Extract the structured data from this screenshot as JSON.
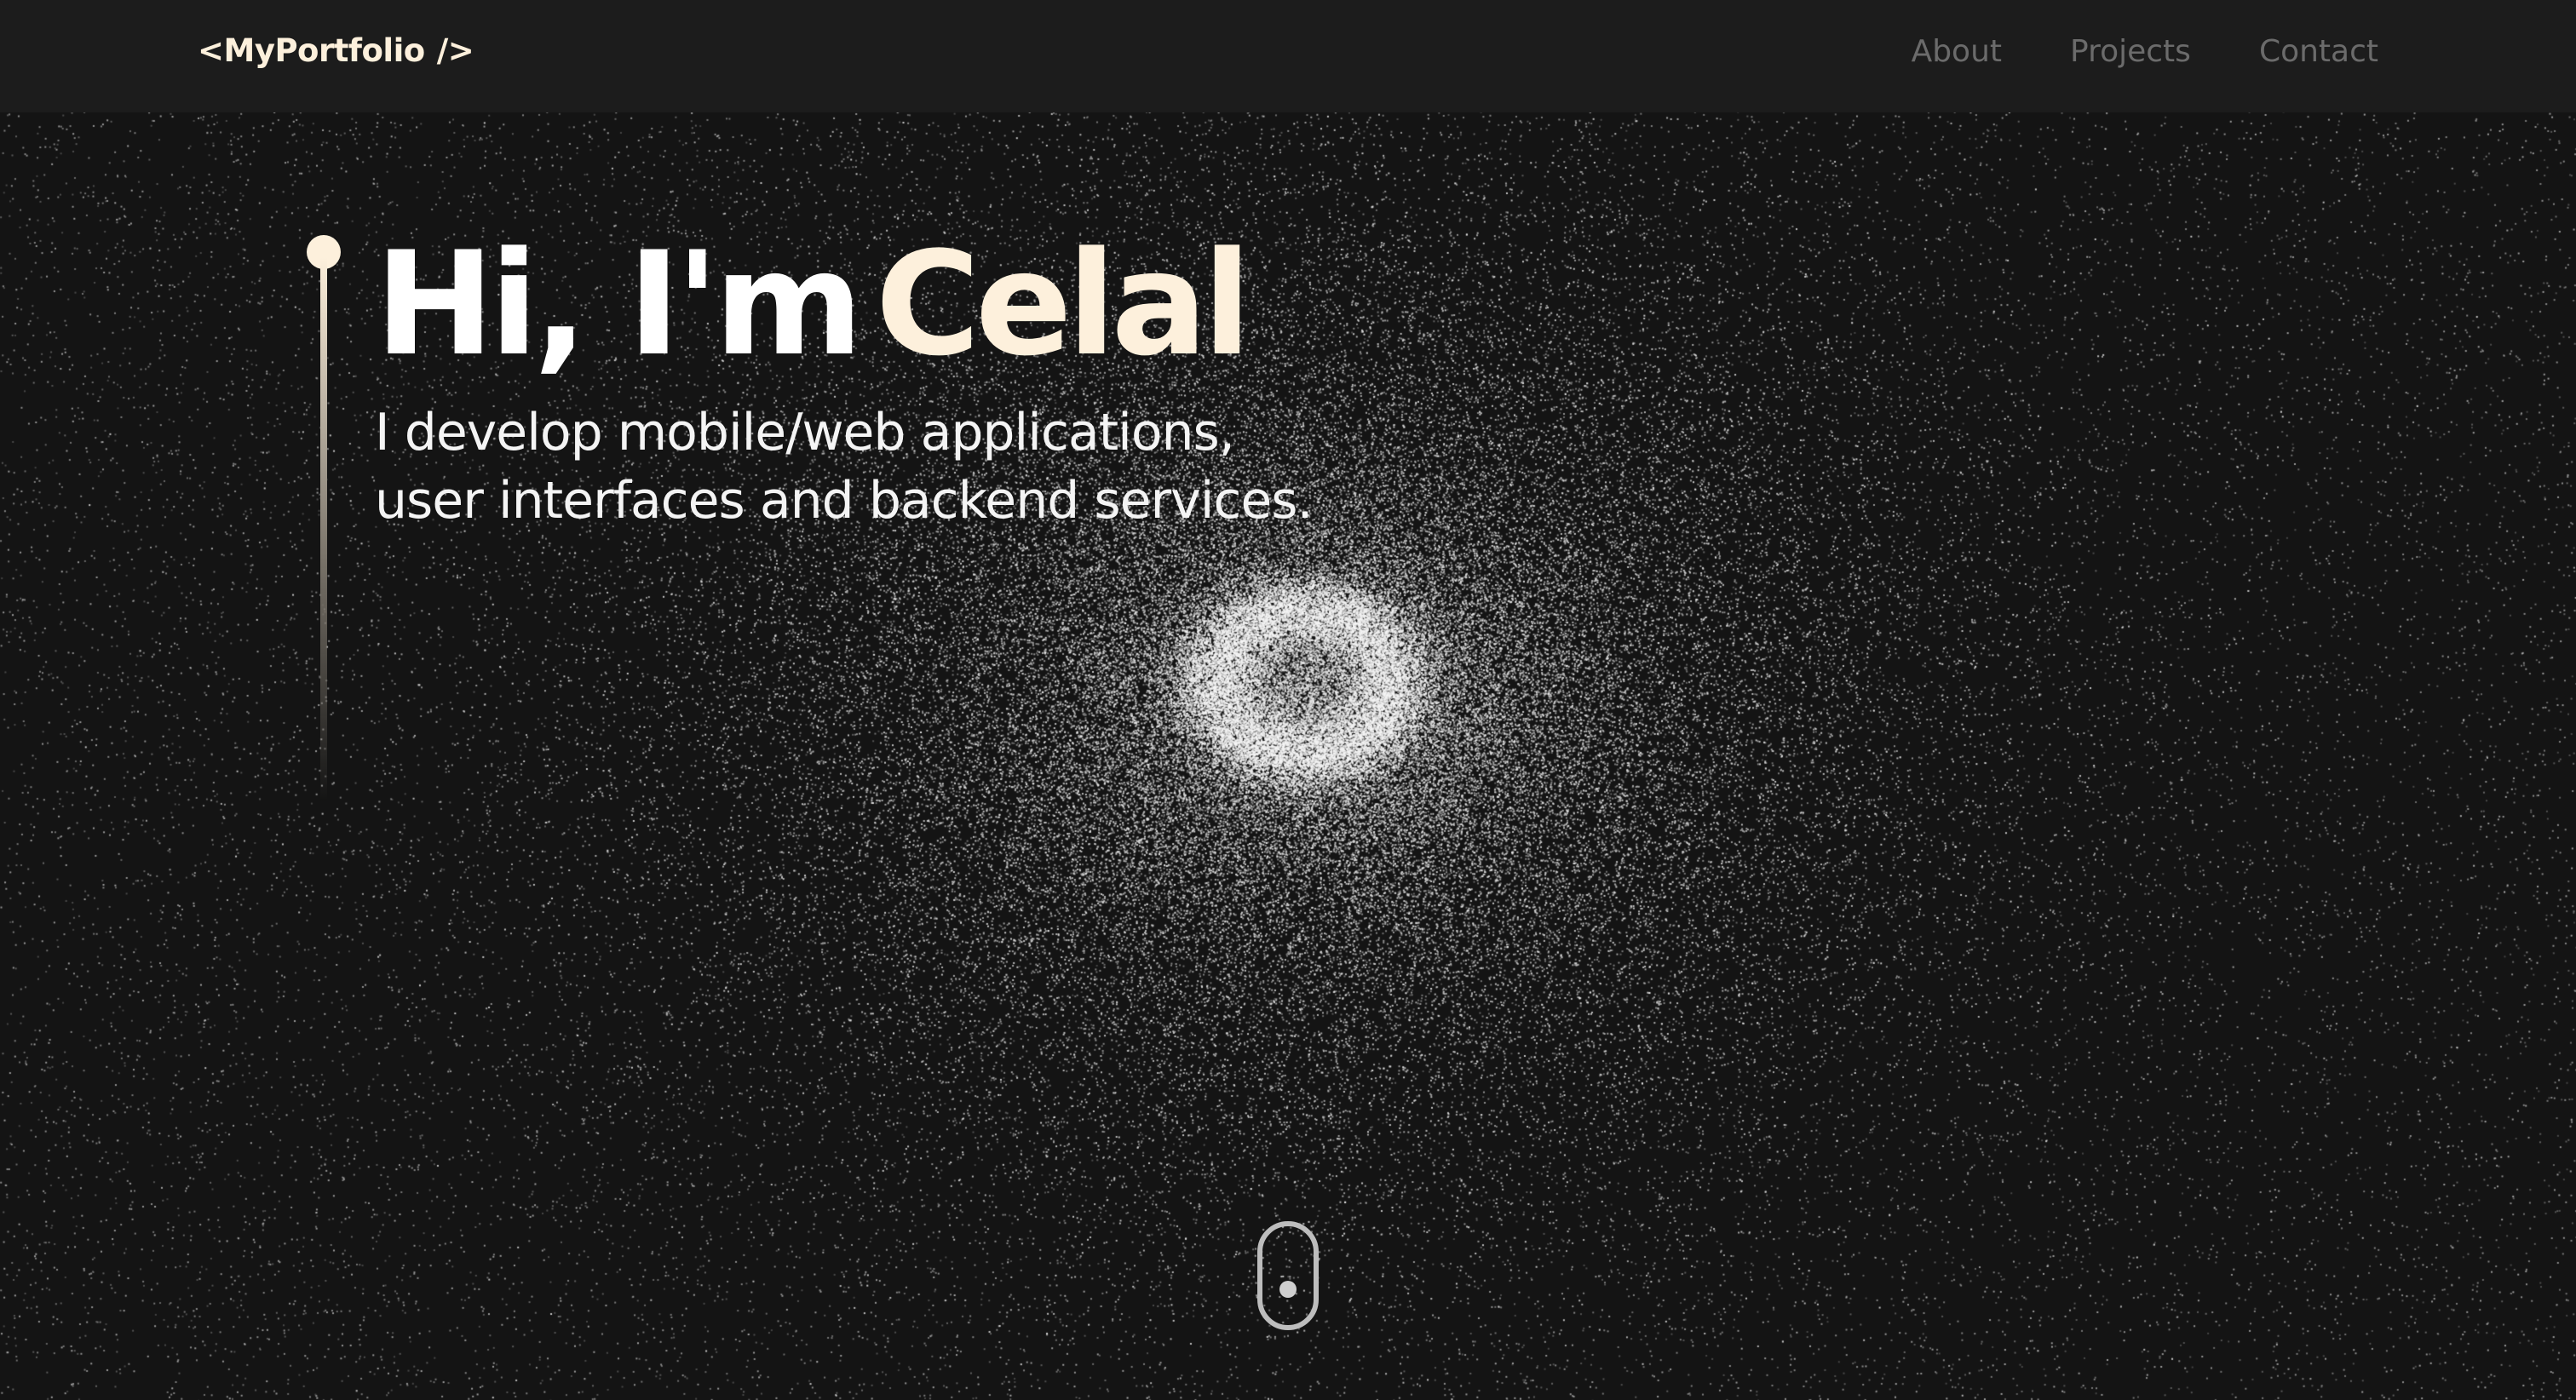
{
  "navbar": {
    "logo_open": "<MyPortfolio",
    "logo_close": "/>",
    "links": [
      {
        "label": "About"
      },
      {
        "label": "Projects"
      },
      {
        "label": "Contact"
      }
    ]
  },
  "hero": {
    "greeting": "Hi, I'm",
    "name": "Celal",
    "subtitle_line1": "I develop mobile/web applications,",
    "subtitle_line2": "user interfaces and backend services."
  },
  "colors": {
    "background": "#141414",
    "navbar": "#1c1c1c",
    "accent": "#fdf0dc",
    "nav_link": "#6b6b6b"
  },
  "icons": {
    "scroll": "mouse-scroll-icon"
  }
}
